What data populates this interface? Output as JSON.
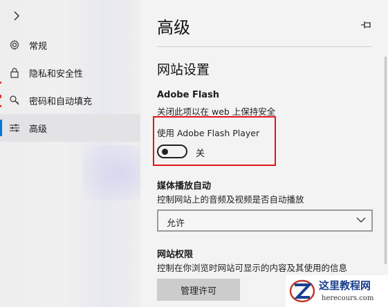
{
  "sidebar": {
    "items": [
      {
        "label": "常规",
        "icon": "gear-icon"
      },
      {
        "label": "隐私和安全性",
        "icon": "lock-icon"
      },
      {
        "label": "密码和自动填充",
        "icon": "key-icon"
      },
      {
        "label": "高级",
        "icon": "sliders-icon",
        "active": true
      }
    ]
  },
  "panel": {
    "title": "高级",
    "section_title": "网站设置",
    "flash": {
      "title": "Adobe Flash",
      "description": "关闭此项以在 web 上保持安全",
      "toggle_label": "使用 Adobe Flash Player",
      "toggle_state": "关",
      "toggle_on": false
    },
    "media": {
      "title": "媒体播放自动",
      "description": "控制网站上的音频及视频是否自动播放",
      "selected": "允许"
    },
    "permissions": {
      "title": "网站权限",
      "description": "控制在你浏览时网站可显示的内容及其使用的信息",
      "button_label": "管理许可"
    }
  },
  "watermark": {
    "title": "这里教程网",
    "url": "herecours.com"
  },
  "colors": {
    "accent": "#0078d7",
    "highlight": "#e0141c"
  }
}
